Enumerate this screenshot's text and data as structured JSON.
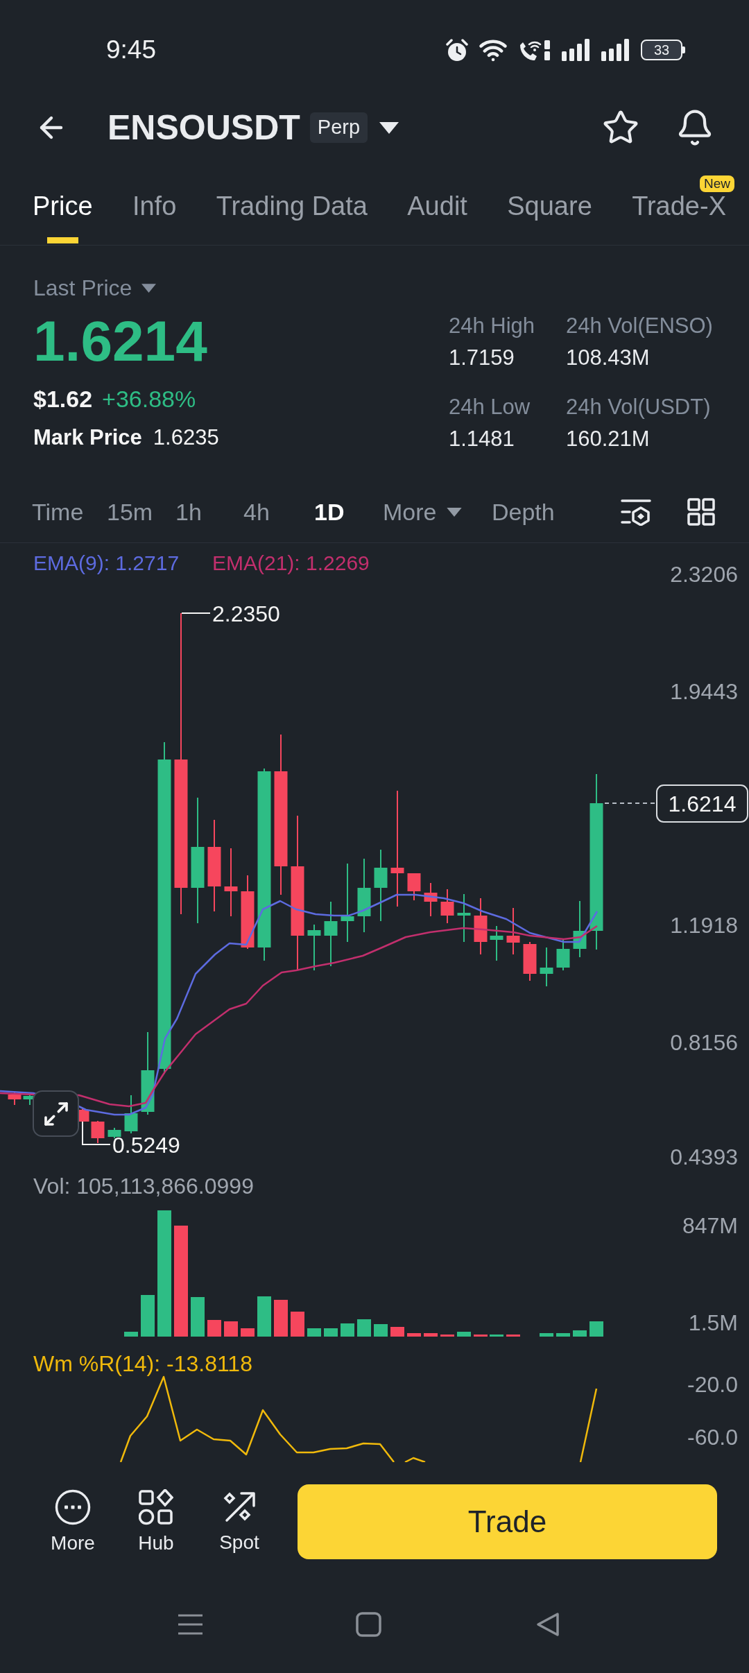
{
  "status_bar": {
    "time": "9:45",
    "battery": "33"
  },
  "header": {
    "symbol": "ENSOUSDT",
    "badge": "Perp"
  },
  "tabs": [
    {
      "label": "Price",
      "selected": true
    },
    {
      "label": "Info",
      "selected": false
    },
    {
      "label": "Trading Data",
      "selected": false
    },
    {
      "label": "Audit",
      "selected": false
    },
    {
      "label": "Square",
      "selected": false
    },
    {
      "label": "Trade-X",
      "selected": false,
      "badge": "New"
    }
  ],
  "price": {
    "selector": "Last Price",
    "last": "1.6214",
    "usd": "$1.62",
    "change": "+36.88%",
    "mark_label": "Mark Price",
    "mark_value": "1.6235"
  },
  "stats": [
    {
      "label": "24h High",
      "value": "1.7159"
    },
    {
      "label": "24h Vol(ENSO)",
      "value": "108.43M"
    },
    {
      "label": "24h Low",
      "value": "1.1481"
    },
    {
      "label": "24h Vol(USDT)",
      "value": "160.21M"
    }
  ],
  "intervals": [
    {
      "label": "Time",
      "kind": "option",
      "selected": false
    },
    {
      "label": "15m",
      "kind": "option",
      "selected": false
    },
    {
      "label": "1h",
      "kind": "option",
      "selected": false
    },
    {
      "label": "4h",
      "kind": "option",
      "selected": false
    },
    {
      "label": "1D",
      "kind": "option",
      "selected": true
    },
    {
      "label": "More",
      "kind": "dropdown",
      "selected": false
    },
    {
      "label": "Depth",
      "kind": "option",
      "selected": false
    }
  ],
  "price_chart": {
    "legend": [
      {
        "label": "EMA(9): 1.2717",
        "color": "#5d6be0"
      },
      {
        "label": "EMA(21): 1.2269",
        "color": "#c22f6d"
      }
    ],
    "y_ticks": [
      "2.3206",
      "1.9443",
      "1.1918",
      "0.8156",
      "0.4393"
    ],
    "high_label": "2.2350",
    "low_label": "0.5249",
    "last_price_tag": "1.6214"
  },
  "volume_chart": {
    "legend": "Vol: 105,113,866.0999",
    "y_ticks": [
      "847M",
      "1.5M"
    ]
  },
  "williams_chart": {
    "legend": "Wm %R(14): -13.8118",
    "y_ticks": [
      "-20.0",
      "-60.0"
    ]
  },
  "actions": [
    {
      "label": "More",
      "kind": "more"
    },
    {
      "label": "Hub",
      "kind": "hub"
    },
    {
      "label": "Spot",
      "kind": "spot"
    }
  ],
  "trade_button": {
    "label": "Trade"
  }
}
